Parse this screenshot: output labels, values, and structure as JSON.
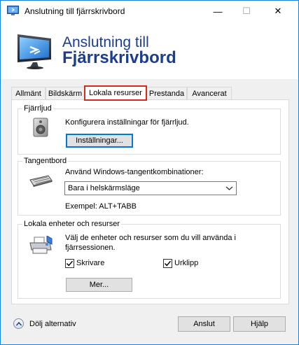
{
  "window": {
    "title": "Anslutning till fjärrskrivbord",
    "controls": {
      "minimize": "—",
      "maximize": "☐",
      "close": "✕"
    }
  },
  "banner": {
    "line1": "Anslutning till",
    "line2": "Fjärrskrivbord",
    "icon": "remote-desktop-monitor-icon"
  },
  "tabs": [
    {
      "label": "Allmänt",
      "selected": false
    },
    {
      "label": "Bildskärm",
      "selected": false
    },
    {
      "label": "Lokala resurser",
      "selected": true
    },
    {
      "label": "Prestanda",
      "selected": false
    },
    {
      "label": "Avancerat",
      "selected": false
    }
  ],
  "remote_audio": {
    "legend": "Fjärrljud",
    "description": "Konfigurera inställningar för fjärrljud.",
    "settings_button": "Inställningar...",
    "icon": "speaker-icon"
  },
  "keyboard": {
    "legend": "Tangentbord",
    "description": "Använd Windows-tangentkombinationer:",
    "selected_option": "Bara i helskärmsläge",
    "example": "Exempel: ALT+TABB",
    "icon": "keyboard-icon"
  },
  "local_devices": {
    "legend": "Lokala enheter och resurser",
    "description_line1": "Välj de enheter och resurser som du vill använda i",
    "description_line2": "fjärrsessionen.",
    "printers_label": "Skrivare",
    "printers_checked": true,
    "clipboard_label": "Urklipp",
    "clipboard_checked": true,
    "more_button": "Mer...",
    "icon": "printer-devices-icon"
  },
  "footer": {
    "hide_options": "Dölj alternativ",
    "connect_button": "Anslut",
    "help_button": "Hjälp"
  },
  "colors": {
    "accent": "#0078d7",
    "banner_text": "#1c3d8f",
    "selected_tab_highlight": "#d9291a"
  }
}
